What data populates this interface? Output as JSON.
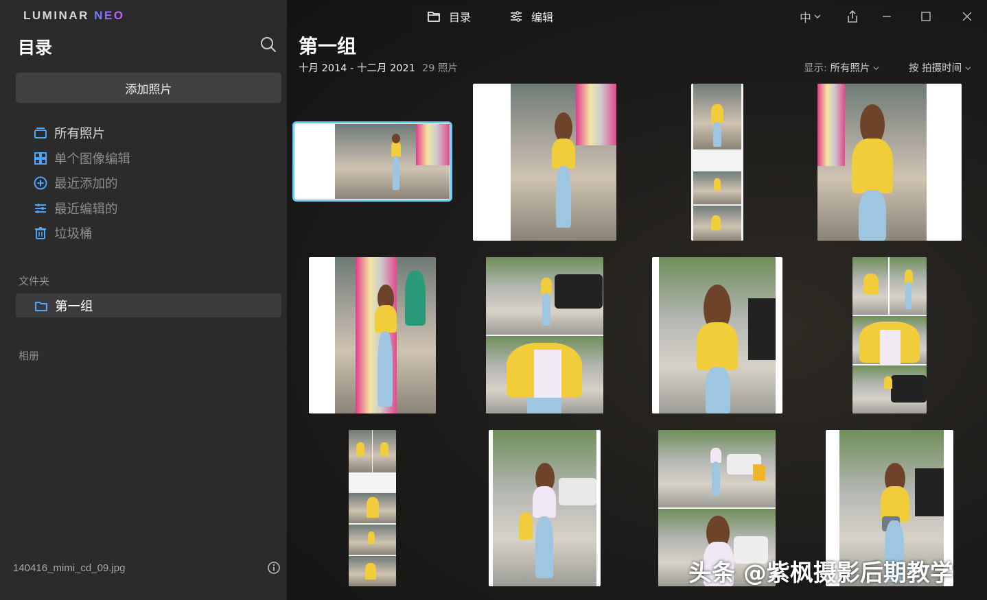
{
  "app": {
    "brand_main": "LUMINAR ",
    "brand_accent": "NEO",
    "language": "中"
  },
  "sidebar": {
    "title": "目录",
    "add_photos": "添加照片",
    "nav": [
      {
        "label": "所有照片",
        "icon": "stack-icon"
      },
      {
        "label": "单个图像编辑",
        "icon": "grid-icon"
      },
      {
        "label": "最近添加的",
        "icon": "plus-circle-icon"
      },
      {
        "label": "最近编辑的",
        "icon": "sliders-icon"
      },
      {
        "label": "垃圾桶",
        "icon": "trash-icon"
      }
    ],
    "folders_label": "文件夹",
    "folder_item": "第一组",
    "albums_label": "相册",
    "current_file": "140416_mimi_cd_09.jpg"
  },
  "topbar": {
    "tabs": [
      {
        "label": "目录",
        "icon": "folder-icon"
      },
      {
        "label": "编辑",
        "icon": "sliders-icon"
      }
    ]
  },
  "main": {
    "group_title": "第一组",
    "date_range": "十月 2014 - 十二月 2021",
    "photo_count": "29 照片",
    "show_label": "显示:",
    "show_value": "所有照片",
    "sort_label": "按 拍摄时间"
  },
  "watermark": "头条 @紫枫摄影后期教学",
  "colors": {
    "accent_selection": "#5fd0ff",
    "sidebar_bg": "#2b2b2b",
    "button_bg": "#414141"
  }
}
